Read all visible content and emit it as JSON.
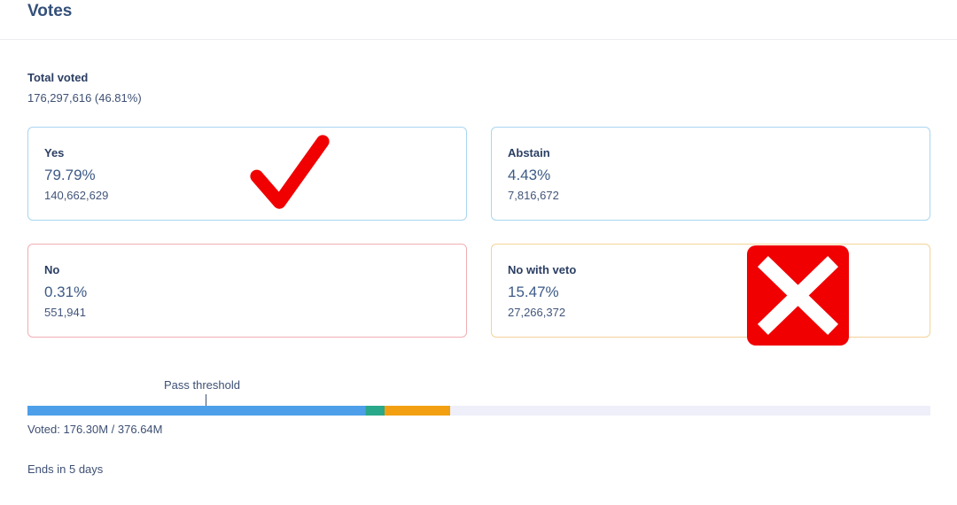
{
  "header": {
    "title": "Votes"
  },
  "total": {
    "label": "Total voted",
    "value": "176,297,616 (46.81%)"
  },
  "options": {
    "yes": {
      "label": "Yes",
      "percent": "79.79%",
      "count": "140,662,629"
    },
    "abstain": {
      "label": "Abstain",
      "percent": "4.43%",
      "count": "7,816,672"
    },
    "no": {
      "label": "No",
      "percent": "0.31%",
      "count": "551,941"
    },
    "veto": {
      "label": "No with veto",
      "percent": "15.47%",
      "count": "27,266,372"
    }
  },
  "bar": {
    "threshold_label": "Pass threshold",
    "voted_text": "Voted: 176.30M / 376.64M",
    "turnout_fraction": 0.4681,
    "option_shares": {
      "yes": 0.7979,
      "no": 0.0031,
      "abstain": 0.0443,
      "veto": 0.1547
    },
    "colors": {
      "yes": "#4c9fe8",
      "no": "#ef5a6a",
      "abstain": "#2aa88a",
      "veto": "#f2a012",
      "track": "#eeeff9"
    }
  },
  "status": {
    "ends_text": "Ends in 5 days"
  },
  "overlays": {
    "checkmark_icon": "red-checkmark-icon",
    "cross_icon": "red-x-icon"
  }
}
